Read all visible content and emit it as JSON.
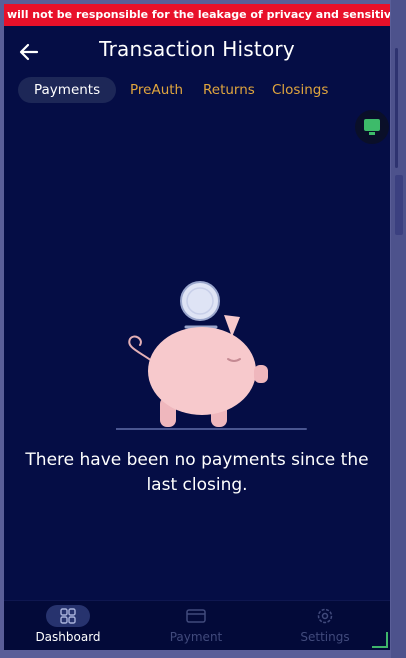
{
  "marquee": "will not be responsible for the leakage of privacy and sensitiv",
  "header": {
    "title": "Transaction History",
    "back_icon": "arrow-left-icon"
  },
  "tabs": [
    {
      "label": "Payments",
      "active": true
    },
    {
      "label": "PreAuth",
      "active": false
    },
    {
      "label": "Returns",
      "active": false
    },
    {
      "label": "Closings",
      "active": false
    }
  ],
  "empty_state": {
    "illustration": "piggy-bank-with-coin",
    "message": "There have been no payments since the last closing."
  },
  "nav": [
    {
      "label": "Dashboard",
      "icon": "grid-icon",
      "active": true
    },
    {
      "label": "Payment",
      "icon": "card-icon",
      "active": false
    },
    {
      "label": "Settings",
      "icon": "gear-icon",
      "active": false
    }
  ],
  "colors": {
    "background": "#050d45",
    "marquee": "#e8102a",
    "tab_inactive": "#e0a53e",
    "tab_active_bg": "#1d2757",
    "piggy": "#f7c9cc",
    "nav_inactive": "#414a7c"
  }
}
